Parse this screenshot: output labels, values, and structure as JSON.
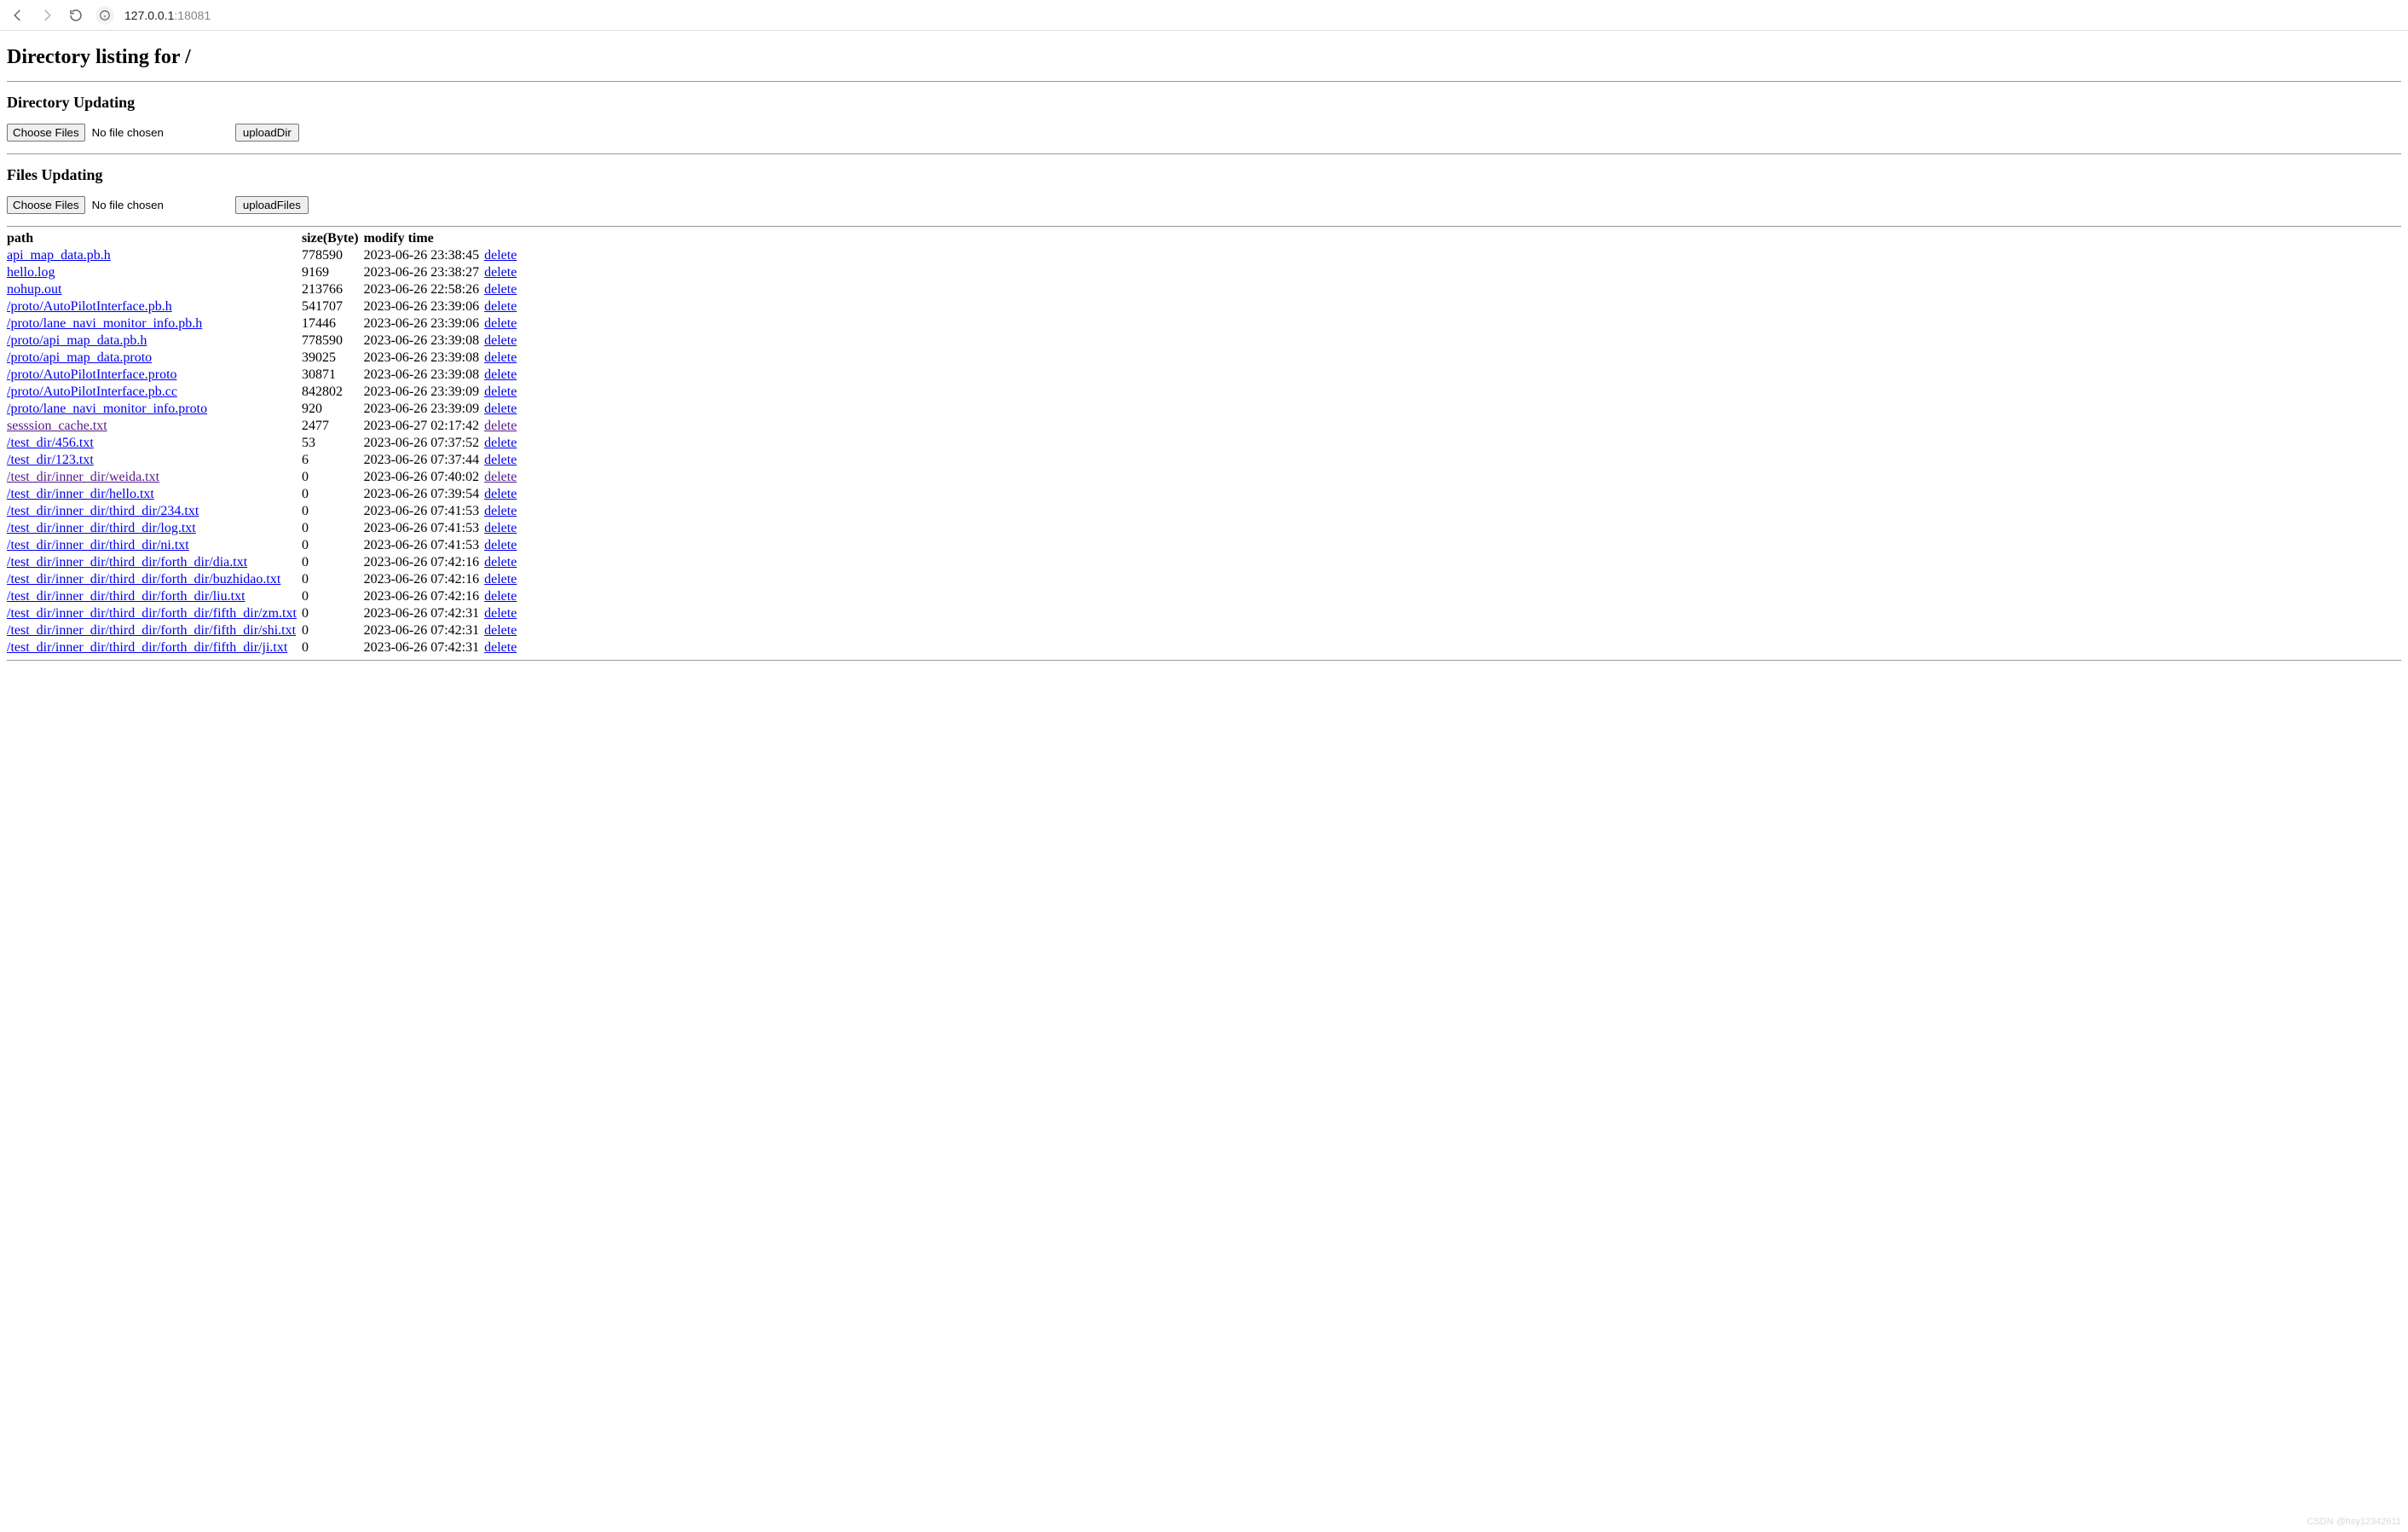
{
  "browser": {
    "url_host": "127.0.0.1",
    "url_port": ":18081"
  },
  "page_title": "Directory listing for /",
  "dir_section": {
    "heading": "Directory Updating",
    "choose_label": "Choose Files",
    "status": "No file chosen",
    "submit_label": "uploadDir"
  },
  "files_section": {
    "heading": "Files Updating",
    "choose_label": "Choose Files",
    "status": "No file chosen",
    "submit_label": "uploadFiles"
  },
  "table": {
    "headers": {
      "path": "path",
      "size": "size(Byte)",
      "mtime": "modify time"
    },
    "delete_label": "delete",
    "rows": [
      {
        "path": "api_map_data.pb.h",
        "size": "778590",
        "mtime": "2023-06-26 23:38:45",
        "visited": false
      },
      {
        "path": "hello.log",
        "size": "9169",
        "mtime": "2023-06-26 23:38:27",
        "visited": false
      },
      {
        "path": "nohup.out",
        "size": "213766",
        "mtime": "2023-06-26 22:58:26",
        "visited": false
      },
      {
        "path": "/proto/AutoPilotInterface.pb.h",
        "size": "541707",
        "mtime": "2023-06-26 23:39:06",
        "visited": false
      },
      {
        "path": "/proto/lane_navi_monitor_info.pb.h",
        "size": "17446",
        "mtime": "2023-06-26 23:39:06",
        "visited": false
      },
      {
        "path": "/proto/api_map_data.pb.h",
        "size": "778590",
        "mtime": "2023-06-26 23:39:08",
        "visited": false
      },
      {
        "path": "/proto/api_map_data.proto",
        "size": "39025",
        "mtime": "2023-06-26 23:39:08",
        "visited": false
      },
      {
        "path": "/proto/AutoPilotInterface.proto",
        "size": "30871",
        "mtime": "2023-06-26 23:39:08",
        "visited": false
      },
      {
        "path": "/proto/AutoPilotInterface.pb.cc",
        "size": "842802",
        "mtime": "2023-06-26 23:39:09",
        "visited": false
      },
      {
        "path": "/proto/lane_navi_monitor_info.proto",
        "size": "920",
        "mtime": "2023-06-26 23:39:09",
        "visited": false
      },
      {
        "path": "sesssion_cache.txt",
        "size": "2477",
        "mtime": "2023-06-27 02:17:42",
        "visited": true
      },
      {
        "path": "/test_dir/456.txt",
        "size": "53",
        "mtime": "2023-06-26 07:37:52",
        "visited": false
      },
      {
        "path": "/test_dir/123.txt",
        "size": "6",
        "mtime": "2023-06-26 07:37:44",
        "visited": false
      },
      {
        "path": "/test_dir/inner_dir/weida.txt",
        "size": "0",
        "mtime": "2023-06-26 07:40:02",
        "visited": true
      },
      {
        "path": "/test_dir/inner_dir/hello.txt",
        "size": "0",
        "mtime": "2023-06-26 07:39:54",
        "visited": false
      },
      {
        "path": "/test_dir/inner_dir/third_dir/234.txt",
        "size": "0",
        "mtime": "2023-06-26 07:41:53",
        "visited": false
      },
      {
        "path": "/test_dir/inner_dir/third_dir/log.txt",
        "size": "0",
        "mtime": "2023-06-26 07:41:53",
        "visited": false
      },
      {
        "path": "/test_dir/inner_dir/third_dir/ni.txt",
        "size": "0",
        "mtime": "2023-06-26 07:41:53",
        "visited": false
      },
      {
        "path": "/test_dir/inner_dir/third_dir/forth_dir/dia.txt",
        "size": "0",
        "mtime": "2023-06-26 07:42:16",
        "visited": false
      },
      {
        "path": "/test_dir/inner_dir/third_dir/forth_dir/buzhidao.txt",
        "size": "0",
        "mtime": "2023-06-26 07:42:16",
        "visited": false
      },
      {
        "path": "/test_dir/inner_dir/third_dir/forth_dir/liu.txt",
        "size": "0",
        "mtime": "2023-06-26 07:42:16",
        "visited": false
      },
      {
        "path": "/test_dir/inner_dir/third_dir/forth_dir/fifth_dir/zm.txt",
        "size": "0",
        "mtime": "2023-06-26 07:42:31",
        "visited": false
      },
      {
        "path": "/test_dir/inner_dir/third_dir/forth_dir/fifth_dir/shi.txt",
        "size": "0",
        "mtime": "2023-06-26 07:42:31",
        "visited": false
      },
      {
        "path": "/test_dir/inner_dir/third_dir/forth_dir/fifth_dir/ji.txt",
        "size": "0",
        "mtime": "2023-06-26 07:42:31",
        "visited": false
      }
    ]
  },
  "watermark": "CSDN @hsy12342611"
}
